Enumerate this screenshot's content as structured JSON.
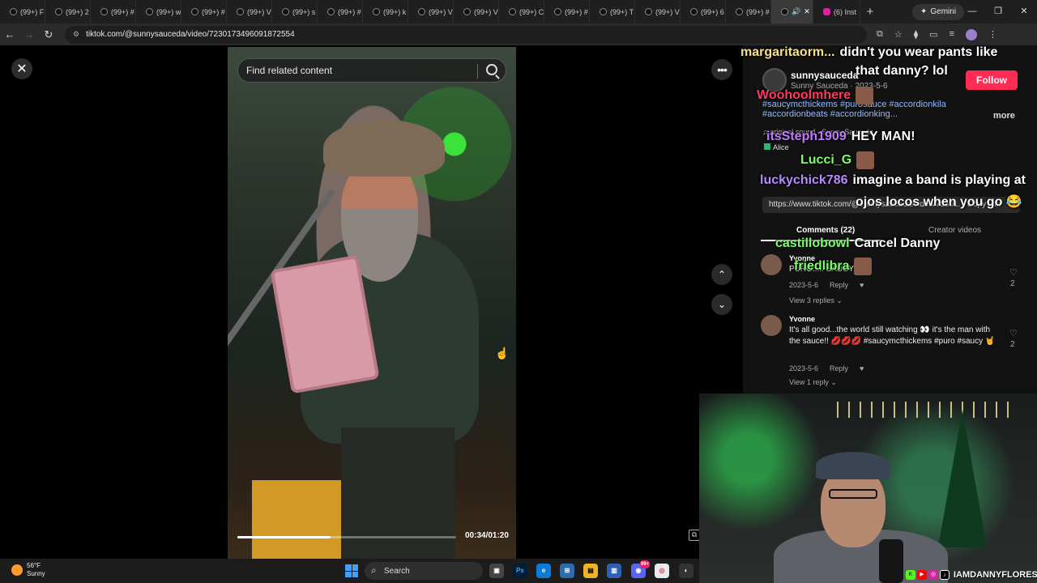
{
  "browser": {
    "tabs": [
      {
        "label": "(99+) F"
      },
      {
        "label": "(99+) 2"
      },
      {
        "label": "(99+) #"
      },
      {
        "label": "(99+) w"
      },
      {
        "label": "(99+) #"
      },
      {
        "label": "(99+) V"
      },
      {
        "label": "(99+) s"
      },
      {
        "label": "(99+) #"
      },
      {
        "label": "(99+) k"
      },
      {
        "label": "(99+) V"
      },
      {
        "label": "(99+) V"
      },
      {
        "label": "(99+) C"
      },
      {
        "label": "(99+) #"
      },
      {
        "label": "(99+) T"
      },
      {
        "label": "(99+) V"
      },
      {
        "label": "(99+) 6"
      },
      {
        "label": "(99+) #"
      }
    ],
    "active_tab_close": "✕",
    "instagram_tab": "(6) Inst",
    "new_tab": "+",
    "gemini_label": "Gemini",
    "window_controls": {
      "minimize": "—",
      "restore": "❐",
      "close": "✕"
    },
    "url": "tiktok.com/@sunnysauceda/video/7230173496091872554"
  },
  "video": {
    "search_placeholder": "Find related content",
    "progress_fraction": 0.425,
    "timecode": "00:34/01:20",
    "close_glyph": "✕",
    "more_glyph": "•••",
    "up_glyph": "⌃",
    "down_glyph": "⌄"
  },
  "panel": {
    "username": "sunnysauceda",
    "display_sub": "Sunny Sauceda · 2023-5-6",
    "follow_label": "Follow",
    "tags_line1": "#saucymcthickems #purosauce #accordionkila",
    "tags_line2": "#accordionbeats #accordionking...",
    "more_label": "more",
    "sound": "♫ original sound - Sunny Sauceda",
    "alice": "Alice",
    "link": "https://www.tiktok.com/@sunnysauceda/video/72301...  Copy link",
    "tab_comments": "Comments (22)",
    "tab_creator": "Creator videos",
    "comments": [
      {
        "name": "Yvonne",
        "text": "PURO..... SAUCY",
        "date": "2023-5-6",
        "reply": "Reply",
        "likes": "2",
        "replies": "View 3 replies ⌄"
      },
      {
        "name": "Yvonne",
        "text": "It's all good...the world still watching 👀 it's the man with the sauce!! 💋💋💋 #saucymcthickems #puro #saucy 🤘",
        "date": "2023-5-6",
        "reply": "Reply",
        "likes": "2",
        "replies": "View 1 reply ⌄"
      }
    ]
  },
  "chat": [
    {
      "name": "margaritaorm...",
      "msg": "didn't you wear pants like",
      "name_color": "#f7e08a"
    },
    {
      "name": "",
      "msg": "that danny? lol",
      "name_color": "#ffffff"
    },
    {
      "name": "Woohoolmhere",
      "msg": "",
      "name_color": "#ff3860"
    },
    {
      "name": "itsSteph1909",
      "msg": "HEY MAN!",
      "name_color": "#c07cff"
    },
    {
      "name": "Lucci_G",
      "msg": "",
      "name_color": "#7cff6b"
    },
    {
      "name": "luckychick786",
      "msg": "imagine a band is playing at",
      "name_color": "#b88aff"
    },
    {
      "name": "",
      "msg": "ojos locos when you go 😂",
      "name_color": "#ffffff"
    },
    {
      "name": "castillobowl",
      "msg": "Cancel Danny",
      "name_color": "#7cff6b"
    },
    {
      "name": "friedlibra",
      "msg": "",
      "name_color": "#7cff6b"
    }
  ],
  "webcam": {
    "handle": "IAMDANNYFLORES"
  },
  "taskbar": {
    "temp": "56°F",
    "condition": "Sunny",
    "search_label": "Search",
    "badge": "99+"
  }
}
